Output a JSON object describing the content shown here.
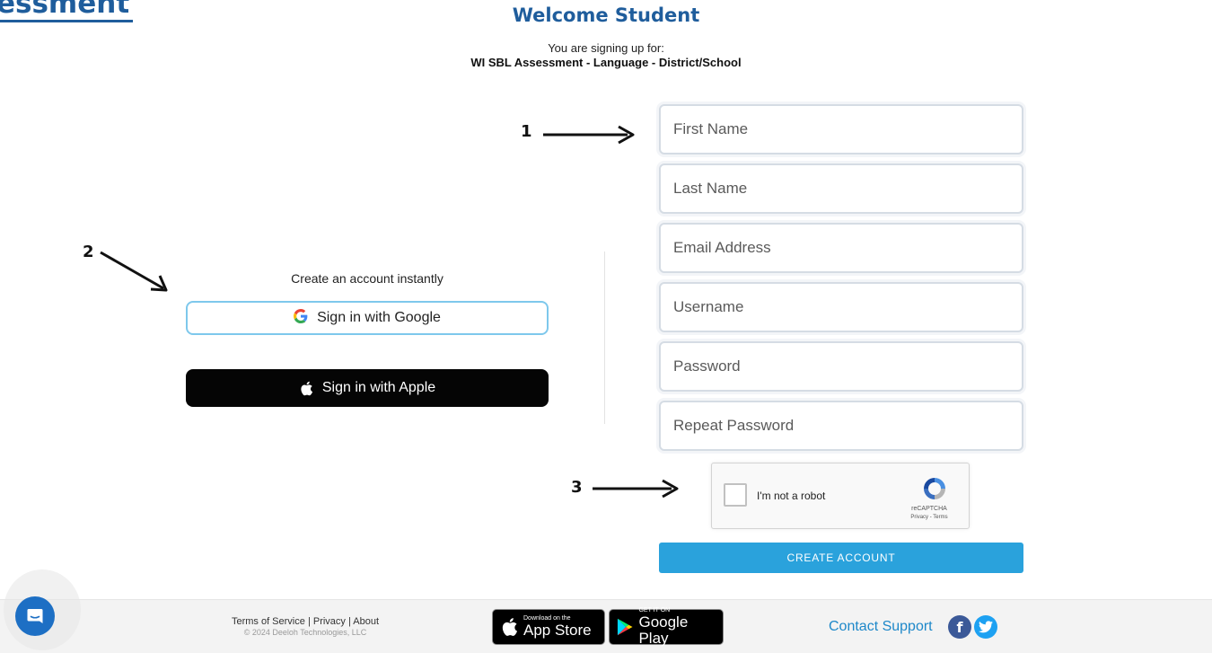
{
  "header": {
    "cut_title": "essment",
    "welcome": "Welcome Student",
    "signing_up_for": "You are signing up for:",
    "assessment_name": "WI SBL Assessment - Language - District/School"
  },
  "annotations": {
    "one": "1",
    "two": "2",
    "three": "3"
  },
  "social_login": {
    "heading": "Create an account instantly",
    "google_label": "Sign in with Google",
    "google_icon": "google-g-icon",
    "apple_label": "Sign in with Apple",
    "apple_icon": "apple-icon"
  },
  "form": {
    "first_name_placeholder": "First Name",
    "last_name_placeholder": "Last Name",
    "email_placeholder": "Email Address",
    "username_placeholder": "Username",
    "password_placeholder": "Password",
    "repeat_password_placeholder": "Repeat Password",
    "captcha_label": "I'm not a robot",
    "captcha_brand": "reCAPTCHA",
    "captcha_links": "Privacy - Terms",
    "create_label": "CREATE ACCOUNT"
  },
  "footer": {
    "terms": "Terms of Service",
    "privacy": "Privacy",
    "about": "About",
    "separator": "|",
    "copyright": "© 2024 Deeloh Technologies, LLC",
    "appstore_small": "Download on the",
    "appstore_big": "App Store",
    "googleplay_small": "GET IT ON",
    "googleplay_big": "Google Play",
    "contact": "Contact Support",
    "facebook_glyph": "f"
  },
  "colors": {
    "brand_blue": "#1f5d9c",
    "button_blue": "#2aa2dc",
    "google_border": "#7ec8ec",
    "facebook": "#3b5998",
    "twitter": "#1da1f2"
  }
}
